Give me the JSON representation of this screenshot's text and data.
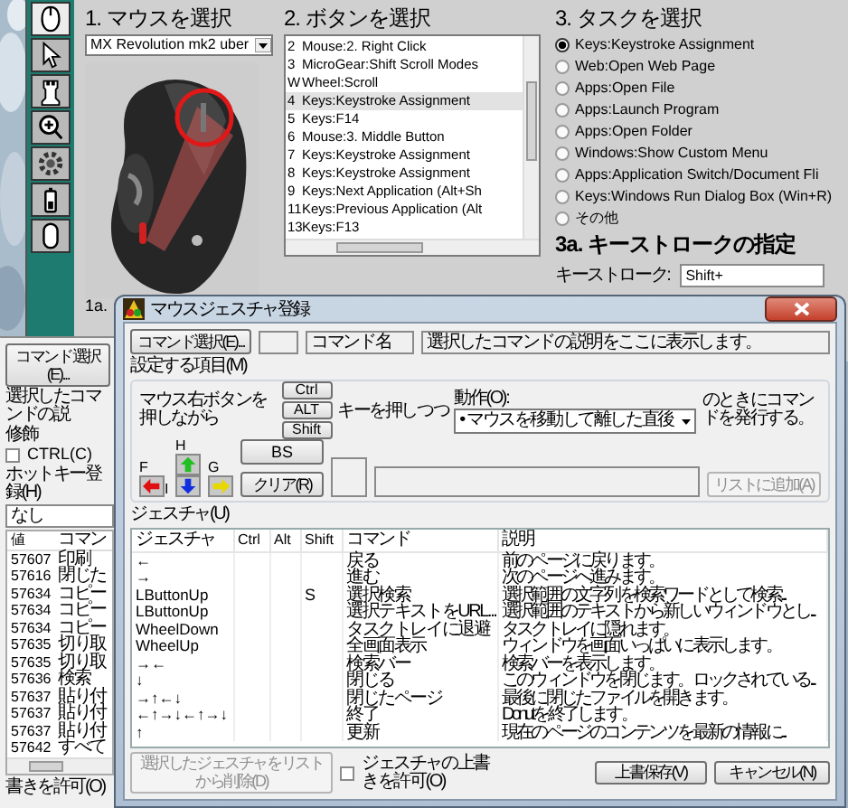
{
  "setpoint_window": {
    "tools": [
      {
        "selected": true
      },
      {
        "selected": false
      },
      {
        "selected": false
      },
      {
        "selected": false
      },
      {
        "selected": false
      },
      {
        "selected": false
      },
      {
        "selected": false
      }
    ],
    "step1": {
      "title": "1. マウスを選択",
      "device": "MX Revolution mk2 uber",
      "sub_label": "1a."
    },
    "step2": {
      "title": "2. ボタンを選択",
      "buttons": [
        {
          "number": "2",
          "action": "Mouse:2. Right Click",
          "selected": false
        },
        {
          "number": "3",
          "action": "MicroGear:Shift Scroll Modes",
          "selected": false
        },
        {
          "number": "W",
          "action": "Wheel:Scroll",
          "selected": false
        },
        {
          "number": "4",
          "action": "Keys:Keystroke Assignment",
          "selected": true
        },
        {
          "number": "5",
          "action": "Keys:F14",
          "selected": false
        },
        {
          "number": "6",
          "action": "Mouse:3. Middle Button",
          "selected": false
        },
        {
          "number": "7",
          "action": "Keys:Keystroke Assignment",
          "selected": false
        },
        {
          "number": "8",
          "action": "Keys:Keystroke Assignment",
          "selected": false
        },
        {
          "number": "9",
          "action": "Keys:Next Application (Alt+Sh",
          "selected": false
        },
        {
          "number": "11",
          "action": "Keys:Previous Application (Alt",
          "selected": false
        },
        {
          "number": "13",
          "action": "Keys:F13",
          "selected": false
        }
      ]
    },
    "step3": {
      "title": "3. タスクを選択",
      "tasks": [
        {
          "label": "Keys:Keystroke Assignment",
          "selected": true
        },
        {
          "label": "Web:Open Web Page",
          "selected": false
        },
        {
          "label": "Apps:Open File",
          "selected": false
        },
        {
          "label": "Apps:Launch Program",
          "selected": false
        },
        {
          "label": "Apps:Open Folder",
          "selected": false
        },
        {
          "label": "Windows:Show Custom Menu",
          "selected": false
        },
        {
          "label": "Apps:Application Switch/Document Fli",
          "selected": false
        },
        {
          "label": "Keys:Windows Run Dialog Box (Win+R)",
          "selected": false
        },
        {
          "label": "その他",
          "selected": false
        }
      ]
    },
    "step3a": {
      "title": "3a. キーストロークの指定",
      "keystroke_label": "キーストローク:",
      "keystroke": "Shift+"
    }
  },
  "command_window": {
    "command_button": "コマンド選択(E)...",
    "description": "選択したコマンドの説",
    "modifier_label": "修飾",
    "ctrl": {
      "label": "CTRL(C)",
      "checked": false
    },
    "hotkey_label": "ホットキー登録(H)",
    "hotkey": "なし",
    "table": {
      "columns": [
        "値",
        "コマン"
      ],
      "rows": [
        {
          "value": "57607",
          "command": "印刷"
        },
        {
          "value": "57616",
          "command": "閉じた"
        },
        {
          "value": "57634",
          "command": "コピー"
        },
        {
          "value": "57634",
          "command": "コピー"
        },
        {
          "value": "57634",
          "command": "コピー"
        },
        {
          "value": "57635",
          "command": "切り取"
        },
        {
          "value": "57635",
          "command": "切り取"
        },
        {
          "value": "57636",
          "command": "検索"
        },
        {
          "value": "57637",
          "command": "貼り付"
        },
        {
          "value": "57637",
          "command": "貼り付"
        },
        {
          "value": "57637",
          "command": "貼り付"
        },
        {
          "value": "57642",
          "command": "すべて"
        }
      ]
    },
    "footer": "書きを許可(O)"
  },
  "dialog": {
    "title": "マウスジェスチャ登録",
    "command_button": "コマンド選択(E)...",
    "command_name": "コマンド名",
    "command_description": "選択したコマンドの説明をここに表示します。",
    "settings_label": "設定する項目(M)",
    "hold_text": "マウス右ボタンを押しながら",
    "modifier_keys": [
      "Ctrl",
      "ALT",
      "Shift"
    ],
    "keys_text": "キーを押しつつ",
    "action_label": "動作(O):",
    "action": "• マウスを移動して離した直後",
    "issue_text": "のときにコマンドを発行する。",
    "directions": [
      {
        "kind": "up",
        "label": "H",
        "color": "#22c022"
      },
      {
        "kind": "left",
        "label": "F",
        "color": "#e01010"
      },
      {
        "kind": "down",
        "label": "I",
        "color": "#1030e0"
      },
      {
        "kind": "right",
        "label": "G",
        "color": "#e8d800"
      }
    ],
    "bs_button": "BS",
    "clear_button": "クリア(R)",
    "add_button": {
      "label": "リストに追加(A)",
      "disabled": true
    },
    "gesture_label": "ジェスチャ(U)",
    "table": {
      "columns": [
        "ジェスチャ",
        "Ctrl",
        "Alt",
        "Shift",
        "コマンド",
        "説明"
      ],
      "rows": [
        {
          "gesture": "←",
          "command": "戻る",
          "description": "前のページに戻ります。"
        },
        {
          "gesture": "→",
          "command": "進む",
          "description": "次のページへ進みます。"
        },
        {
          "gesture": "LButtonUp",
          "shift": "S",
          "command": "選択検索",
          "description": "選択範囲の文字列を検索ワードとして検索..."
        },
        {
          "gesture": "LButtonUp",
          "command": "選択テキストをURL...",
          "description": "選択範囲のテキストから新しいウィンドウとし..."
        },
        {
          "gesture": "WheelDown",
          "command": "タスクトレイに退避",
          "description": "タスクトレイに隠れます。"
        },
        {
          "gesture": "WheelUp",
          "command": "全画面表示",
          "description": "ウィンドウを画面いっぱいに表示します。"
        },
        {
          "gesture": "→←",
          "command": "検索バー",
          "description": "検索バーを表示します。"
        },
        {
          "gesture": "↓",
          "command": "閉じる",
          "description": "このウィンドウを閉じます。ロックされている..."
        },
        {
          "gesture": "→↑←↓",
          "command": "閉じたページ",
          "description": "最後に閉じたファイルを開きます。"
        },
        {
          "gesture": "←↑→↓←↑→↓",
          "command": "終了",
          "description": "Donutを終了します。"
        },
        {
          "gesture": "↑",
          "command": "更新",
          "description": "現在のページのコンテンツを最新の情報に..."
        }
      ]
    },
    "delete_button": {
      "label": "選択したジェスチャをリストから削除(D)",
      "disabled": true
    },
    "overwrite": {
      "label": "ジェスチャの上書きを許可(O)",
      "checked": false
    },
    "save_button": "上書保存(V)",
    "cancel_button": "キャンセル(N)"
  }
}
